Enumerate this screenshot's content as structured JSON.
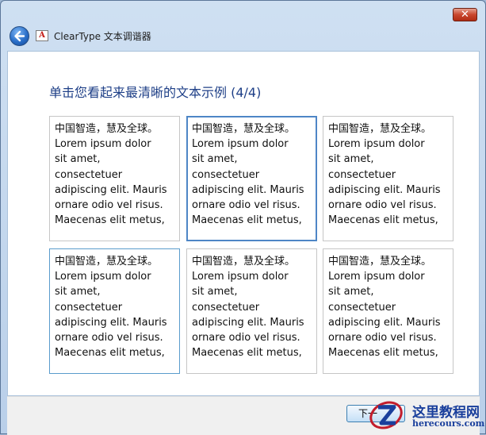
{
  "window": {
    "title": "ClearType 文本调谐器",
    "close_label": "✕",
    "app_icon_letter": "A"
  },
  "heading": "单击您看起来最清晰的文本示例 (4/4)",
  "samples": [
    {
      "line1": "中国智造，慧及全球。",
      "body": "Lorem ipsum dolor\nsit amet,\nconsectetuer\nadipiscing elit. Mauris\nornare odio vel risus.\nMaecenas elit metus,"
    },
    {
      "line1": "中国智造，慧及全球。",
      "body": "Lorem ipsum dolor\nsit amet,\nconsectetuer\nadipiscing elit. Mauris\nornare odio vel risus.\nMaecenas elit metus,"
    },
    {
      "line1": "中国智造，慧及全球。",
      "body": "Lorem ipsum dolor\nsit amet,\nconsectetuer\nadipiscing elit. Mauris\nornare odio vel risus.\nMaecenas elit metus,"
    },
    {
      "line1": "中国智造，慧及全球。",
      "body": "Lorem ipsum dolor\nsit amet,\nconsectetuer\nadipiscing elit. Mauris\nornare odio vel risus.\nMaecenas elit metus,"
    },
    {
      "line1": "中国智造，慧及全球。",
      "body": "Lorem ipsum dolor\nsit amet,\nconsectetuer\nadipiscing elit. Mauris\nornare odio vel risus.\nMaecenas elit metus,"
    },
    {
      "line1": "中国智造，慧及全球。",
      "body": "Lorem ipsum dolor\nsit amet,\nconsectetuer\nadipiscing elit. Mauris\nornare odio vel risus.\nMaecenas elit metus,"
    }
  ],
  "selected_sample_index": 1,
  "footer": {
    "next_label": "下一"
  },
  "watermark": {
    "title": "这里教程网",
    "subtitle": "herecours.com"
  },
  "colors": {
    "heading": "#1e3f87",
    "selected_border": "#4e86c6",
    "close_button": "#c9462d"
  },
  "icons": {
    "back": "back-arrow-icon",
    "app": "cleartype-app-icon",
    "close": "close-icon"
  }
}
